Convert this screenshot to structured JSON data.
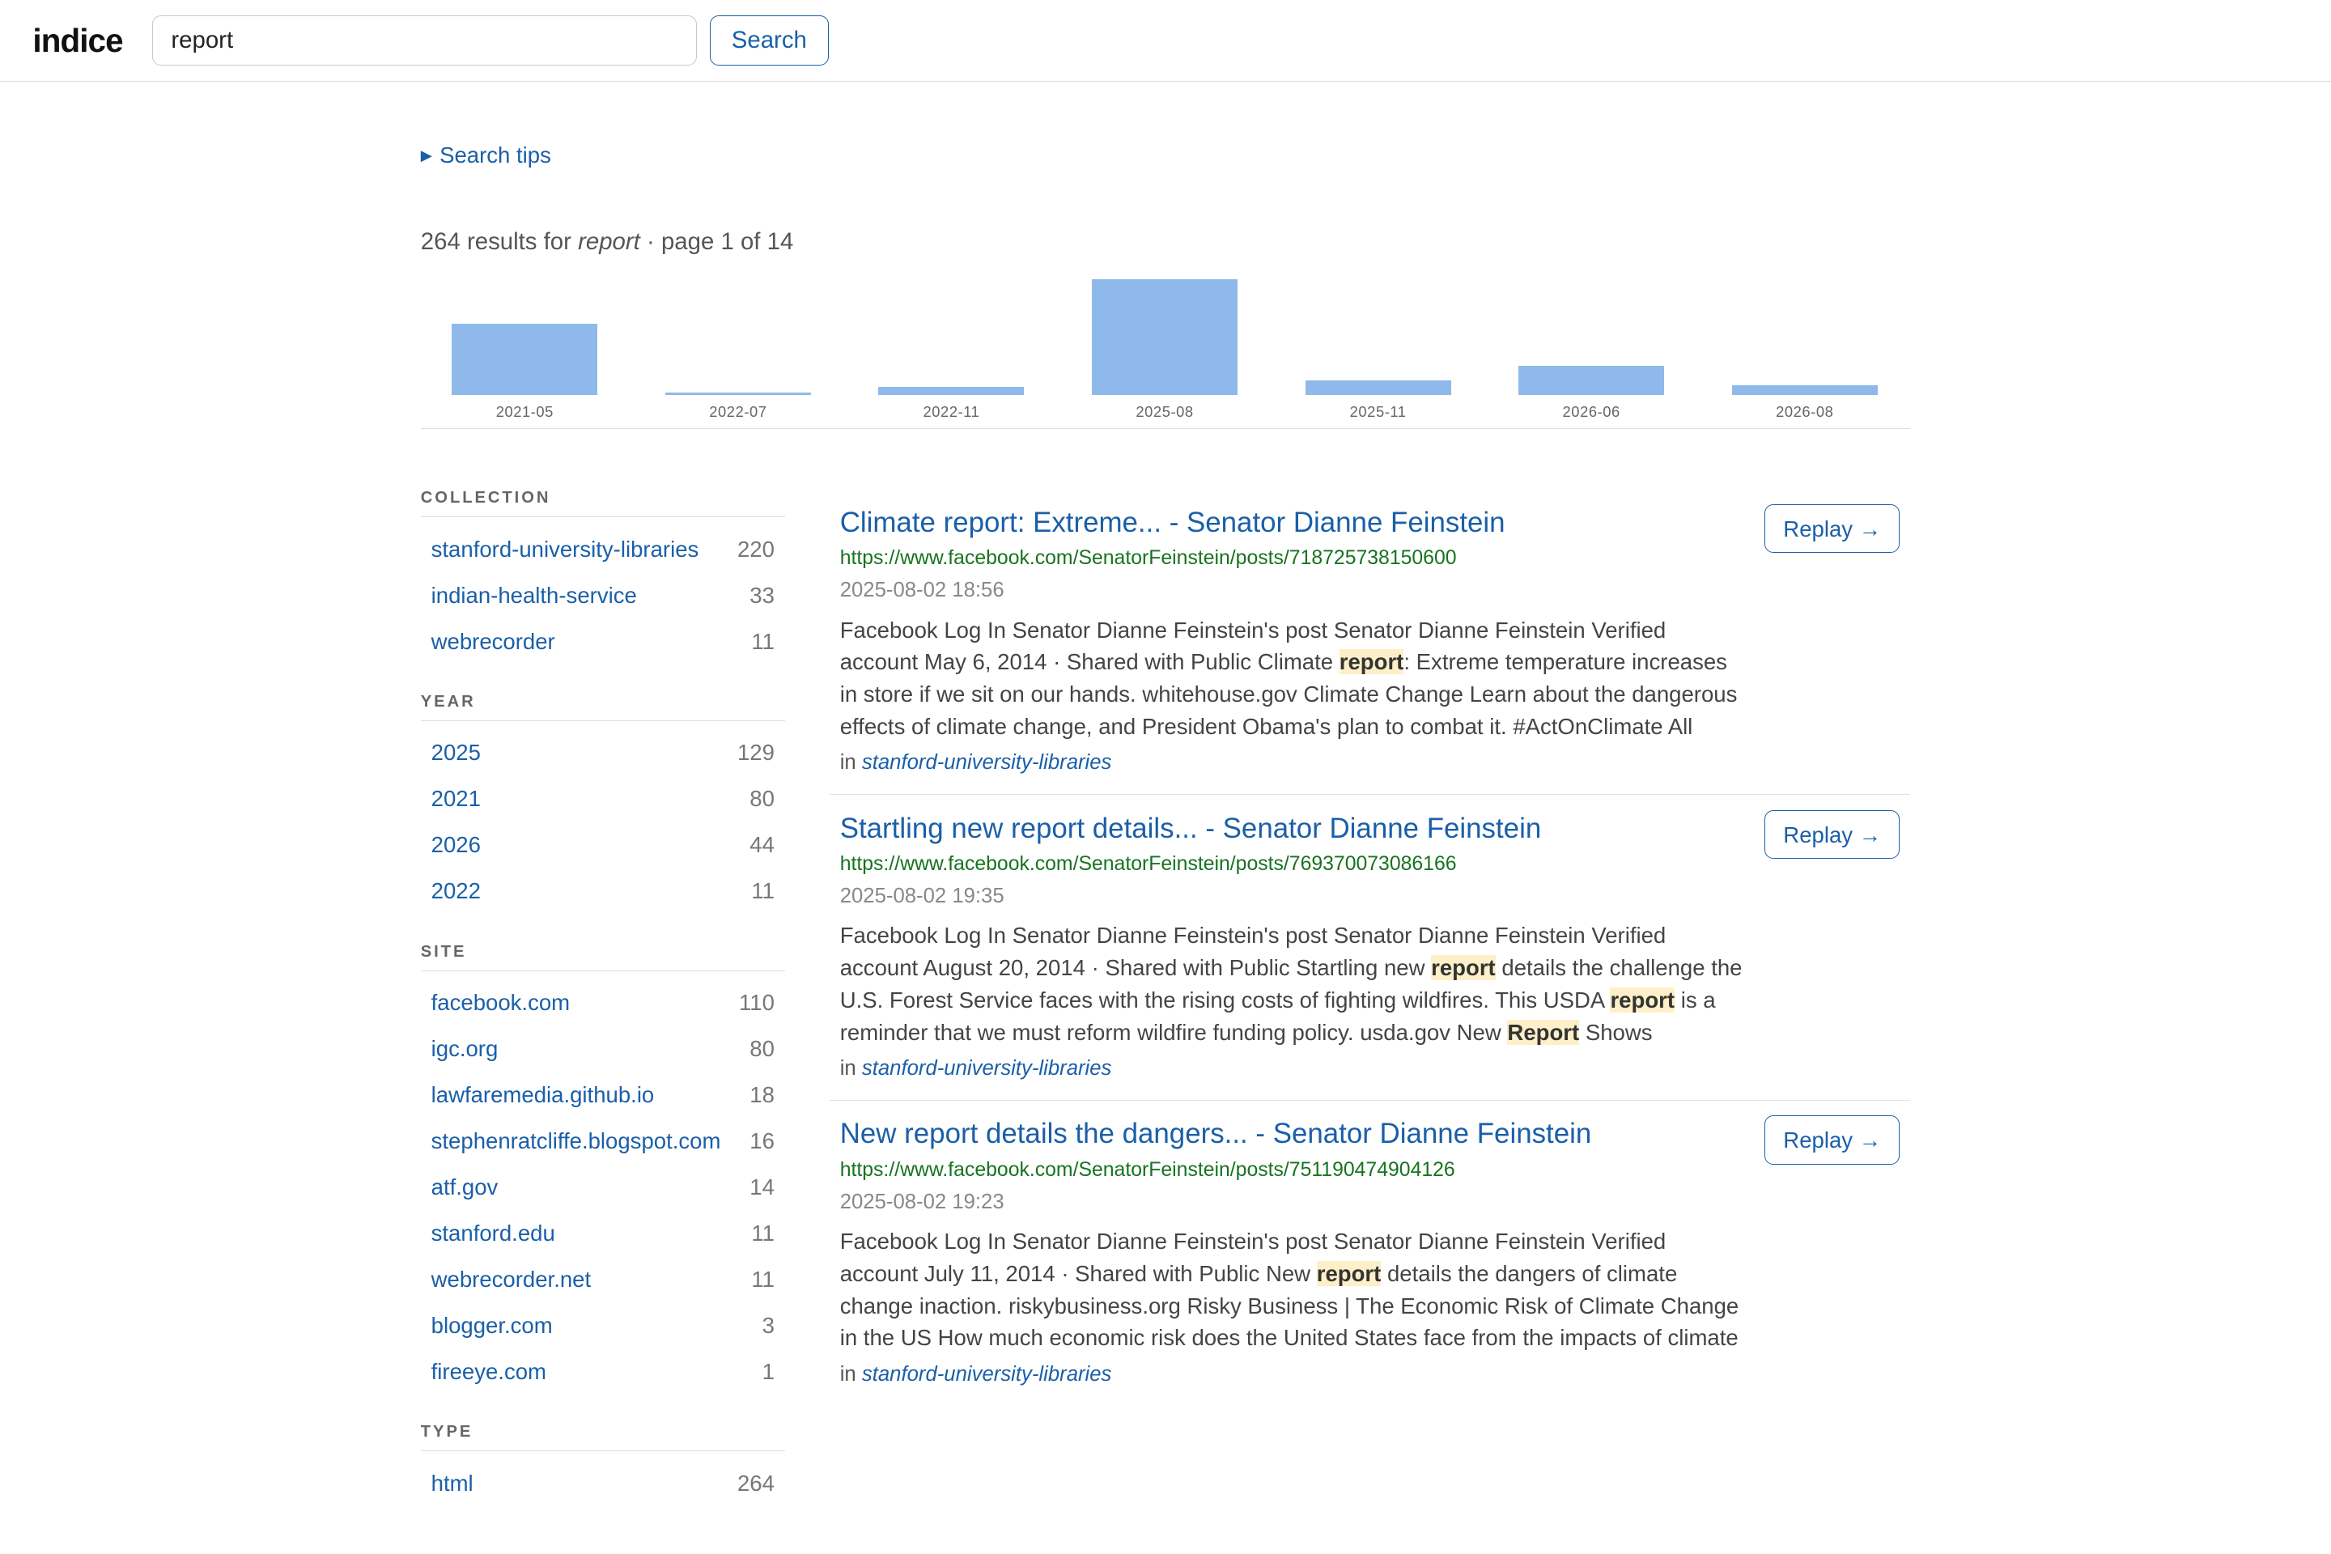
{
  "header": {
    "logo": "indice",
    "search_value": "report",
    "search_button": "Search"
  },
  "tips_label": "Search tips",
  "summary": {
    "prefix": "264 results for",
    "query": "report",
    "suffix": "· page 1 of 14"
  },
  "chart_data": {
    "type": "bar",
    "categories": [
      "2021-05",
      "2022-07",
      "2022-11",
      "2025-08",
      "2025-11",
      "2026-06",
      "2026-08"
    ],
    "values": [
      80,
      2,
      9,
      129,
      17,
      33,
      11
    ],
    "ylim": [
      0,
      129
    ],
    "title": "",
    "xlabel": "",
    "ylabel": "",
    "grid": false
  },
  "facets": [
    {
      "title": "COLLECTION",
      "items": [
        {
          "name": "stanford-university-libraries",
          "count": "220"
        },
        {
          "name": "indian-health-service",
          "count": "33"
        },
        {
          "name": "webrecorder",
          "count": "11"
        }
      ]
    },
    {
      "title": "YEAR",
      "items": [
        {
          "name": "2025",
          "count": "129"
        },
        {
          "name": "2021",
          "count": "80"
        },
        {
          "name": "2026",
          "count": "44"
        },
        {
          "name": "2022",
          "count": "11"
        }
      ]
    },
    {
      "title": "SITE",
      "items": [
        {
          "name": "facebook.com",
          "count": "110"
        },
        {
          "name": "igc.org",
          "count": "80"
        },
        {
          "name": "lawfaremedia.github.io",
          "count": "18"
        },
        {
          "name": "stephenratcliffe.blogspot.com",
          "count": "16"
        },
        {
          "name": "atf.gov",
          "count": "14"
        },
        {
          "name": "stanford.edu",
          "count": "11"
        },
        {
          "name": "webrecorder.net",
          "count": "11"
        },
        {
          "name": "blogger.com",
          "count": "3"
        },
        {
          "name": "fireeye.com",
          "count": "1"
        }
      ]
    },
    {
      "title": "TYPE",
      "items": [
        {
          "name": "html",
          "count": "264"
        }
      ]
    }
  ],
  "results": [
    {
      "title": "Climate report: Extreme... - Senator Dianne Feinstein",
      "url": "https://www.facebook.com/SenatorFeinstein/posts/718725738150600",
      "date": "2025-08-02 18:56",
      "snippet": [
        {
          "t": "Facebook Log In Senator Dianne Feinstein's post Senator Dianne Feinstein Verified account May 6, 2014 · Shared with Public Climate "
        },
        {
          "t": "report",
          "hl": true
        },
        {
          "t": ": Extreme temperature increases in store if we sit on our hands. whitehouse.gov Climate Change Learn about the dangerous effects of climate change, and President Obama's plan to combat it. #ActOnClimate All"
        }
      ],
      "in_label": "in",
      "collection": "stanford-university-libraries",
      "replay": "Replay →"
    },
    {
      "title": "Startling new report details... - Senator Dianne Feinstein",
      "url": "https://www.facebook.com/SenatorFeinstein/posts/769370073086166",
      "date": "2025-08-02 19:35",
      "snippet": [
        {
          "t": "Facebook Log In Senator Dianne Feinstein's post Senator Dianne Feinstein Verified account August 20, 2014 · Shared with Public Startling new "
        },
        {
          "t": "report",
          "hl": true
        },
        {
          "t": " details the challenge the U.S. Forest Service faces with the rising costs of fighting wildfires. This USDA "
        },
        {
          "t": "report",
          "hl": true
        },
        {
          "t": " is a reminder that we must reform wildfire funding policy. usda.gov New "
        },
        {
          "t": "Report",
          "hl": true
        },
        {
          "t": " Shows"
        }
      ],
      "in_label": "in",
      "collection": "stanford-university-libraries",
      "replay": "Replay →"
    },
    {
      "title": "New report details the dangers... - Senator Dianne Feinstein",
      "url": "https://www.facebook.com/SenatorFeinstein/posts/751190474904126",
      "date": "2025-08-02 19:23",
      "snippet": [
        {
          "t": "Facebook Log In Senator Dianne Feinstein's post Senator Dianne Feinstein Verified account July 11, 2014 · Shared with Public New "
        },
        {
          "t": "report",
          "hl": true
        },
        {
          "t": " details the dangers of climate change inaction. riskybusiness.org Risky Business | The Economic Risk of Climate Change in the US How much economic risk does the United States face from the impacts of climate"
        }
      ],
      "in_label": "in",
      "collection": "stanford-university-libraries",
      "replay": "Replay →"
    }
  ]
}
